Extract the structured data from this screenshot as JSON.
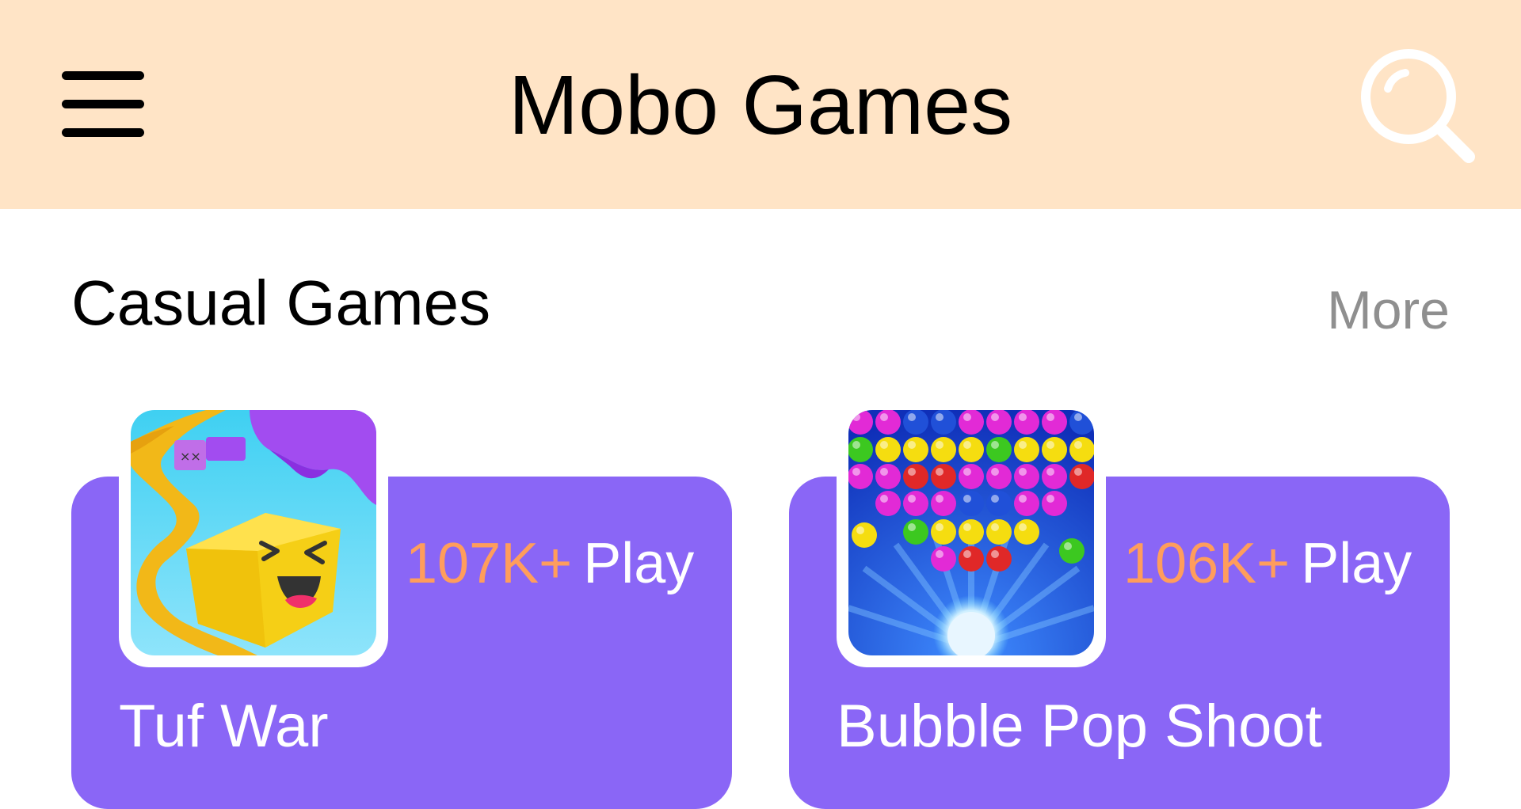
{
  "header": {
    "title": "Mobo Games",
    "menu_icon": "hamburger-menu-icon",
    "search_icon": "search-icon",
    "background": "#FFE4C6"
  },
  "section": {
    "title": "Casual Games",
    "more_label": "More"
  },
  "games": [
    {
      "name": "Tuf War",
      "play_count": "107K+",
      "play_label": "Play",
      "thumbnail_icon": "tuf-war-cube-icon"
    },
    {
      "name": "Bubble Pop Shoot",
      "play_count": "106K+",
      "play_label": "Play",
      "thumbnail_icon": "bubble-shooter-icon"
    }
  ],
  "colors": {
    "card": "#8A66F6",
    "play_count": "#FF9D5C",
    "more": "#8f8f8f"
  }
}
